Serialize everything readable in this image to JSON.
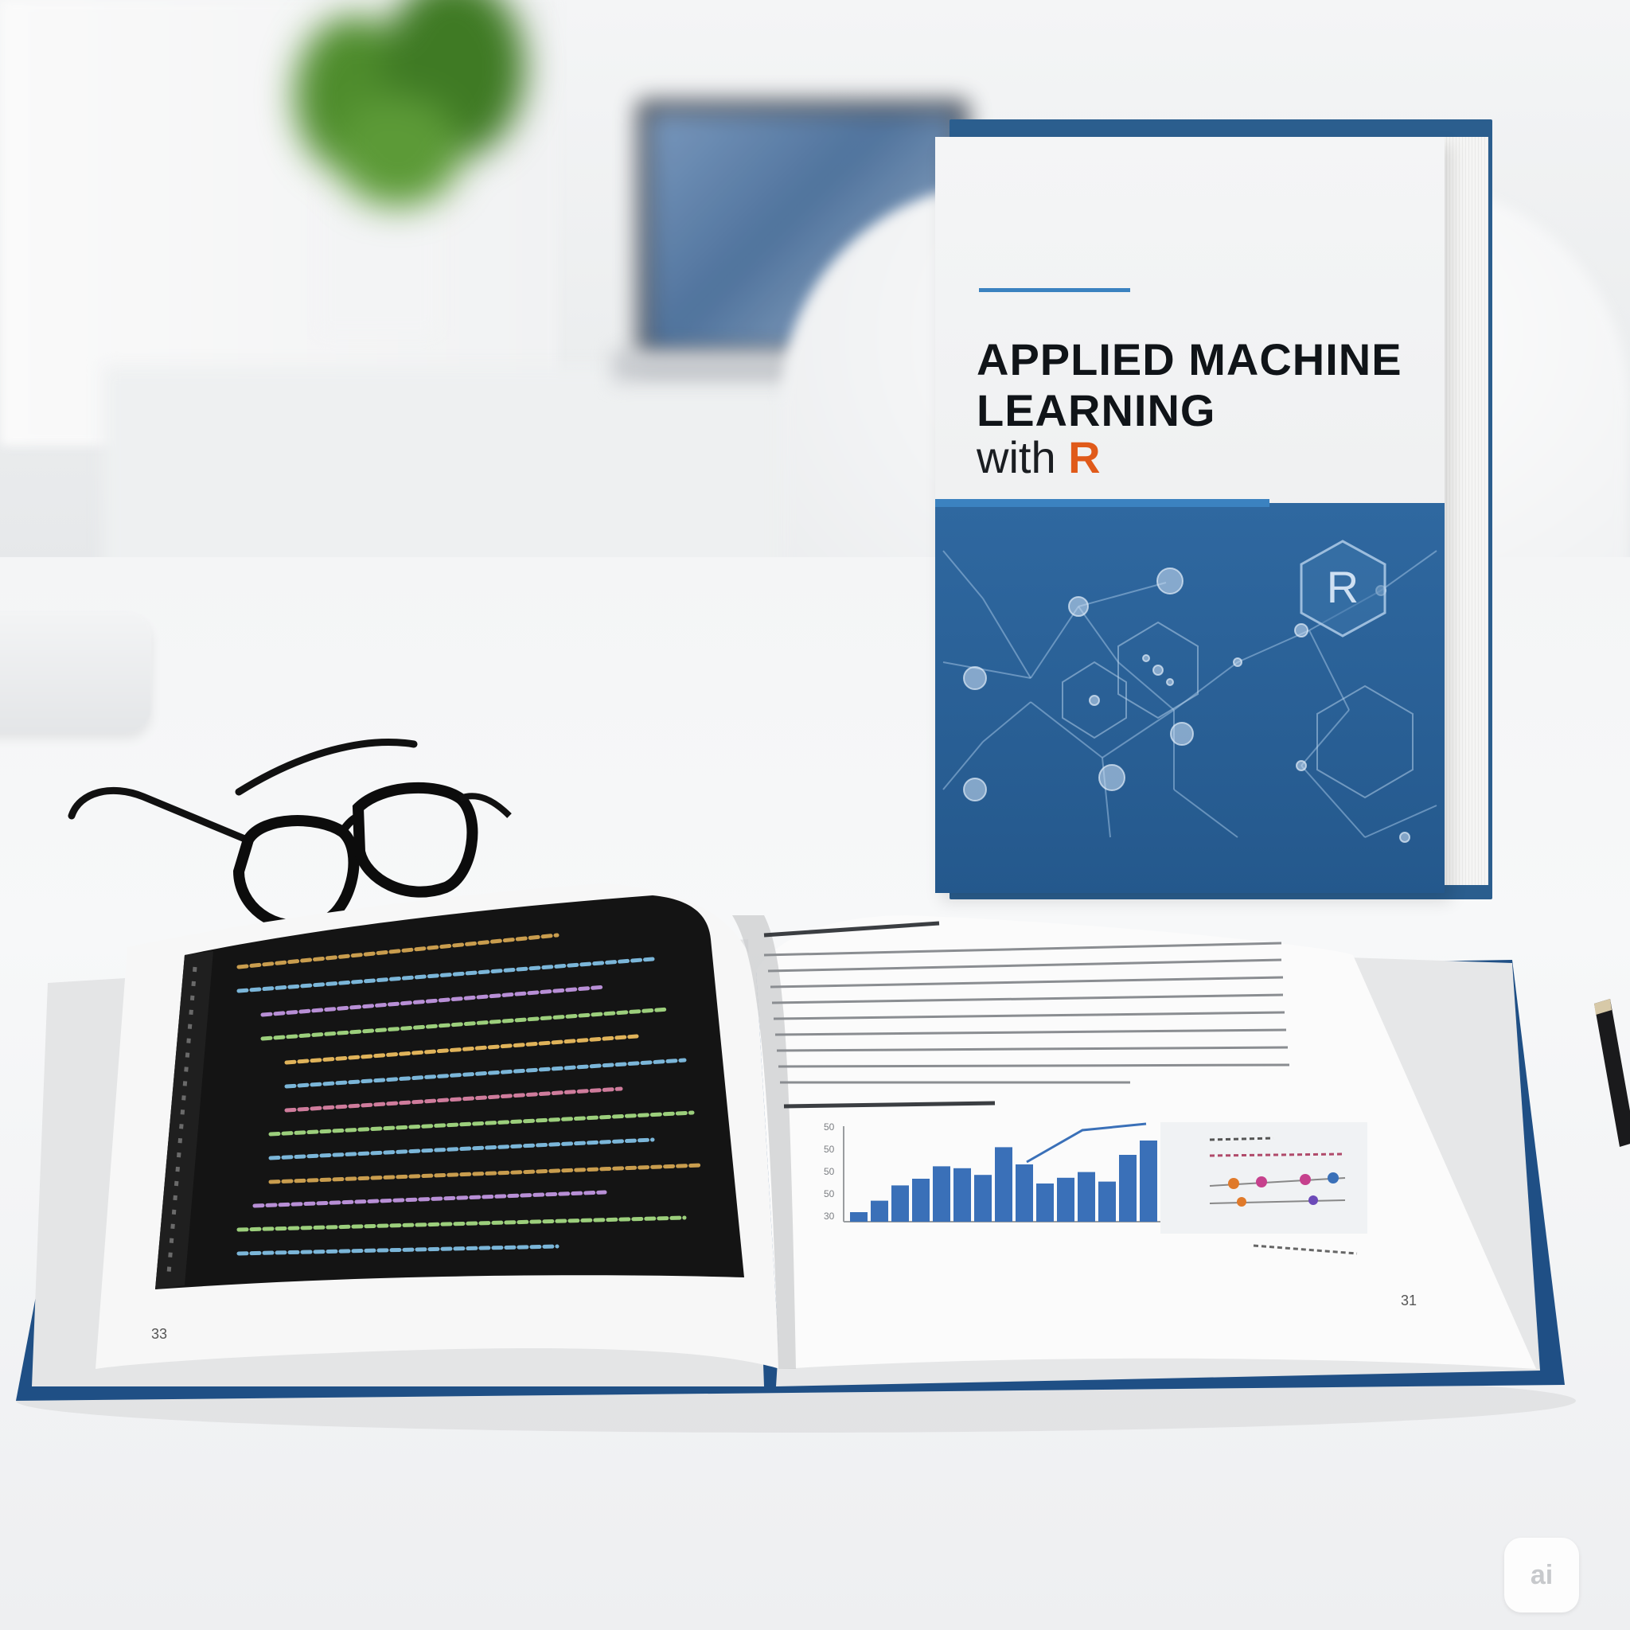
{
  "book_cover": {
    "title_line_1": "APPLIED MACHINE",
    "title_line_2": "LEARNING",
    "subtitle_prefix": "with",
    "subtitle_highlight": "R",
    "badge_letter": "R",
    "colors": {
      "cover_blue": "#2a5e92",
      "accent_rule": "#3b82c0",
      "r_orange": "#e05a1a",
      "title_ink": "#101418"
    }
  },
  "open_book": {
    "left_page_number": "33",
    "right_page_number": "31",
    "code_screen_theme": "dark",
    "chart": {
      "type": "bar",
      "y_ticks": [
        "50",
        "50",
        "50",
        "50",
        "30"
      ],
      "values": [
        10,
        22,
        38,
        45,
        58,
        56,
        49,
        78,
        60,
        40,
        46,
        52,
        42,
        70,
        85
      ],
      "bar_color": "#3a70b8"
    }
  },
  "props": [
    "glasses-icon",
    "pencil-icon",
    "plant",
    "laptop"
  ],
  "watermark": {
    "label": "ai"
  }
}
